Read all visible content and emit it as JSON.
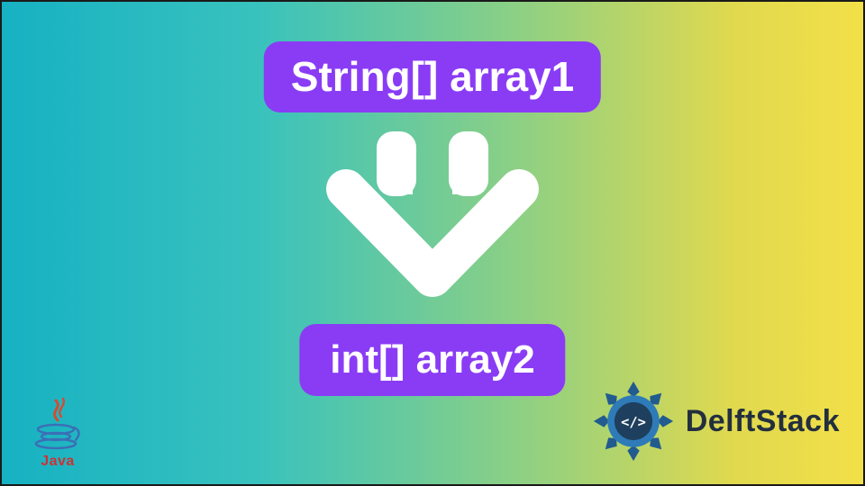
{
  "diagram": {
    "top_label": "String[] array1",
    "bottom_label": "int[] array2",
    "arrow_direction": "down",
    "badge_bg": "#8a3cf5",
    "badge_fg": "#ffffff",
    "arrow_color": "#ffffff"
  },
  "gradient": {
    "from": "#16b1c3",
    "to": "#f3e048"
  },
  "logos": {
    "java": {
      "name": "java-logo-icon",
      "text": "Java"
    },
    "delftstack": {
      "name": "delftstack-logo-icon",
      "text": "DelftStack"
    }
  }
}
